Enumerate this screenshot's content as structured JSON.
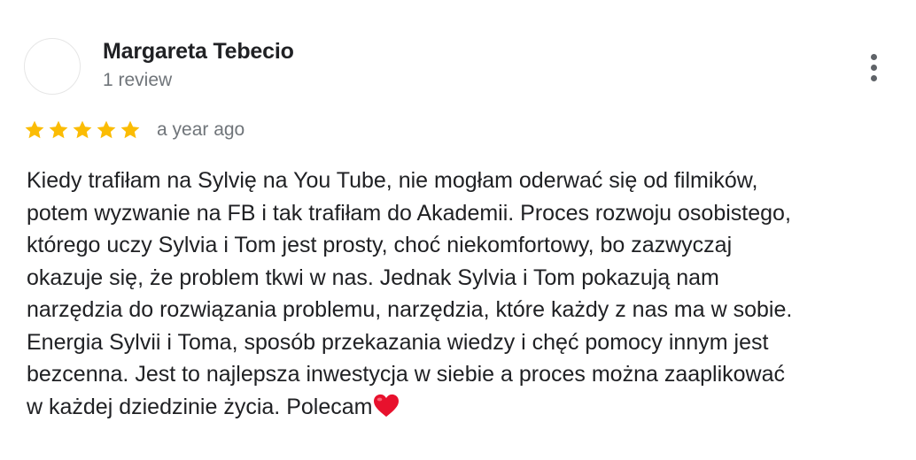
{
  "reviewer": {
    "name": "Margareta Tebecio",
    "review_count": "1 review"
  },
  "rating": {
    "stars": 5,
    "max": 5,
    "star_color": "#fbbc04",
    "time": "a year ago"
  },
  "review": {
    "lines": [
      "Kiedy trafiłam na Sylvię na You Tube, nie mogłam oderwać się od filmików,",
      "potem wyzwanie na FB i tak trafiłam do Akademii. Proces rozwoju osobistego,",
      "którego uczy Sylvia i Tom jest prosty, choć niekomfortowy, bo zazwyczaj",
      "okazuje się, że problem tkwi w nas. Jednak Sylvia i Tom pokazują nam",
      "narzędzia do rozwiązania problemu, narzędzia, które każdy z nas ma w sobie.",
      "Energia Sylvii i Toma, sposób przekazania wiedzy i chęć pomocy innym jest",
      "bezcenna. Jest to najlepsza inwestycja w siebie a proces można zaaplikować",
      "w każdej dziedzinie życia. Polecam"
    ],
    "end_emoji": "heart-emoji",
    "heart_color": "#e8112d"
  },
  "icons": {
    "more_menu": "more-vert-icon",
    "star": "star-icon"
  }
}
